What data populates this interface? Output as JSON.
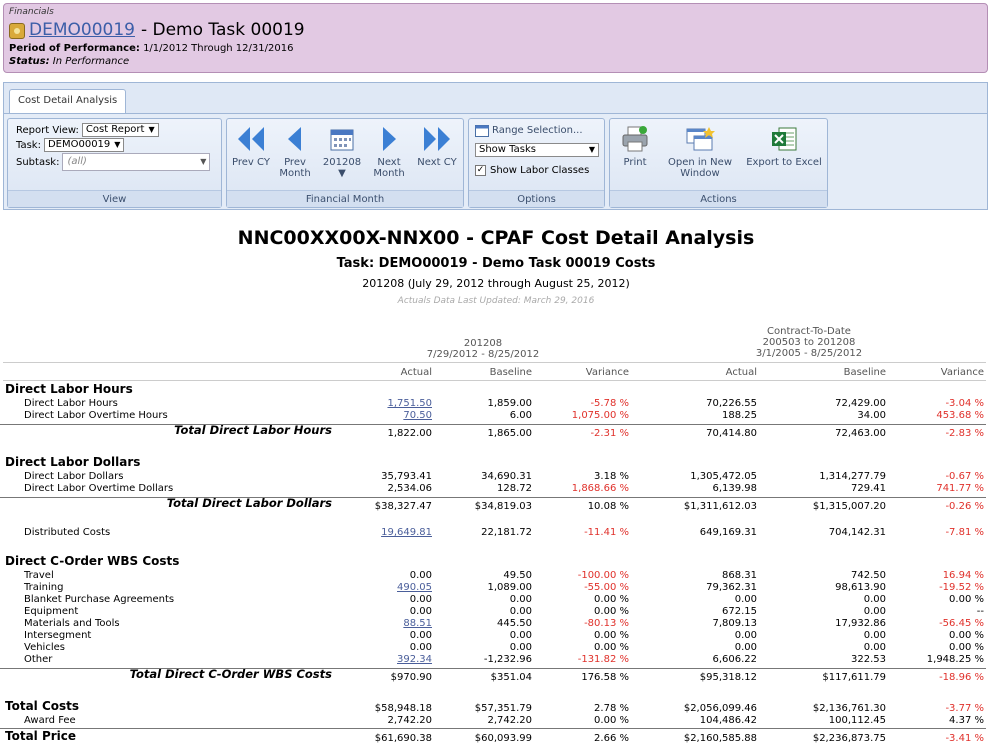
{
  "header": {
    "category": "Financials",
    "task_link": "DEMO00019",
    "task_name": "- Demo Task 00019",
    "pop_label": "Period of Performance:",
    "pop_value": "1/1/2012 Through 12/31/2016",
    "status_label": "Status:",
    "status_value": "In Performance",
    "bg_color": "#e2c9e3"
  },
  "ribbon": {
    "tab": "Cost Detail Analysis",
    "view": {
      "report_view_label": "Report View:",
      "report_view_value": "Cost Report",
      "task_label": "Task:",
      "task_value": "DEMO00019",
      "subtask_label": "Subtask:",
      "subtask_placeholder": "(all)",
      "caption": "View"
    },
    "month": {
      "prev_cy": "Prev CY",
      "prev_month_1": "Prev",
      "prev_month_2": "Month",
      "current": "201208",
      "next_month_1": "Next",
      "next_month_2": "Month",
      "next_cy": "Next CY",
      "caption": "Financial Month"
    },
    "options": {
      "range_selection": "Range Selection...",
      "show_tasks": "Show Tasks",
      "show_labor_classes": "Show Labor Classes",
      "show_labor_checked": true,
      "caption": "Options"
    },
    "actions": {
      "print": "Print",
      "open_new_1": "Open in New",
      "open_new_2": "Window",
      "export": "Export to Excel",
      "caption": "Actions"
    }
  },
  "report": {
    "title": "NNC00XX00X-NNX00 - CPAF Cost Detail Analysis",
    "subtitle": "Task: DEMO00019 - Demo Task 00019 Costs",
    "period": "201208 (July 29, 2012 through August 25, 2012)",
    "updated": "Actuals Data Last Updated: March 29, 2016",
    "period_header": {
      "line1": "201208",
      "line2": "7/29/2012 - 8/25/2012"
    },
    "ctd_header": {
      "line1": "Contract-To-Date",
      "line2": "200503 to 201208",
      "line3": "3/1/2005 - 8/25/2012"
    },
    "columns": [
      "Actual",
      "Baseline",
      "Variance",
      "Actual",
      "Baseline",
      "Variance"
    ],
    "sections": {
      "labor_hours": "Direct Labor Hours",
      "labor_dollars": "Direct Labor Dollars",
      "corder": "Direct C-Order WBS Costs",
      "total_costs": "Total Costs",
      "total_price": "Total Price"
    },
    "rows": {
      "dlh": [
        "Direct Labor Hours",
        "1,751.50",
        "1,859.00",
        "-5.78 %",
        "70,226.55",
        "72,429.00",
        "-3.04 %"
      ],
      "dloh": [
        "Direct Labor Overtime Hours",
        "70.50",
        "6.00",
        "1,075.00 %",
        "188.25",
        "34.00",
        "453.68 %"
      ],
      "tdlh": [
        "Total Direct Labor Hours",
        "1,822.00",
        "1,865.00",
        "-2.31 %",
        "70,414.80",
        "72,463.00",
        "-2.83 %"
      ],
      "dld": [
        "Direct Labor Dollars",
        "35,793.41",
        "34,690.31",
        "3.18 %",
        "1,305,472.05",
        "1,314,277.79",
        "-0.67 %"
      ],
      "dlod": [
        "Direct Labor Overtime Dollars",
        "2,534.06",
        "128.72",
        "1,868.66 %",
        "6,139.98",
        "729.41",
        "741.77 %"
      ],
      "tdld": [
        "Total Direct Labor Dollars",
        "$38,327.47",
        "$34,819.03",
        "10.08 %",
        "$1,311,612.03",
        "$1,315,007.20",
        "-0.26 %"
      ],
      "dist": [
        "Distributed Costs",
        "19,649.81",
        "22,181.72",
        "-11.41 %",
        "649,169.31",
        "704,142.31",
        "-7.81 %"
      ],
      "travel": [
        "Travel",
        "0.00",
        "49.50",
        "-100.00 %",
        "868.31",
        "742.50",
        "16.94 %"
      ],
      "training": [
        "Training",
        "490.05",
        "1,089.00",
        "-55.00 %",
        "79,362.31",
        "98,613.90",
        "-19.52 %"
      ],
      "bpa": [
        "Blanket Purchase Agreements",
        "0.00",
        "0.00",
        "0.00 %",
        "0.00",
        "0.00",
        "0.00 %"
      ],
      "equip": [
        "Equipment",
        "0.00",
        "0.00",
        "0.00 %",
        "672.15",
        "0.00",
        "--"
      ],
      "mat": [
        "Materials and Tools",
        "88.51",
        "445.50",
        "-80.13 %",
        "7,809.13",
        "17,932.86",
        "-56.45 %"
      ],
      "interseg": [
        "Intersegment",
        "0.00",
        "0.00",
        "0.00 %",
        "0.00",
        "0.00",
        "0.00 %"
      ],
      "veh": [
        "Vehicles",
        "0.00",
        "0.00",
        "0.00 %",
        "0.00",
        "0.00",
        "0.00 %"
      ],
      "other": [
        "Other",
        "392.34",
        "-1,232.96",
        "-131.82 %",
        "6,606.22",
        "322.53",
        "1,948.25 %"
      ],
      "tcorder": [
        "Total Direct C-Order WBS Costs",
        "$970.90",
        "$351.04",
        "176.58 %",
        "$95,318.12",
        "$117,611.79",
        "-18.96 %"
      ],
      "tcosts": [
        "Total Costs",
        "$58,948.18",
        "$57,351.79",
        "2.78 %",
        "$2,056,099.46",
        "$2,136,761.30",
        "-3.77 %"
      ],
      "fee": [
        "Award Fee",
        "2,742.20",
        "2,742.20",
        "0.00 %",
        "104,486.42",
        "100,112.45",
        "4.37 %"
      ],
      "tprice": [
        "Total Price",
        "$61,690.38",
        "$60,093.99",
        "2.66 %",
        "$2,160,585.88",
        "$2,236,873.75",
        "-3.41 %"
      ]
    }
  }
}
